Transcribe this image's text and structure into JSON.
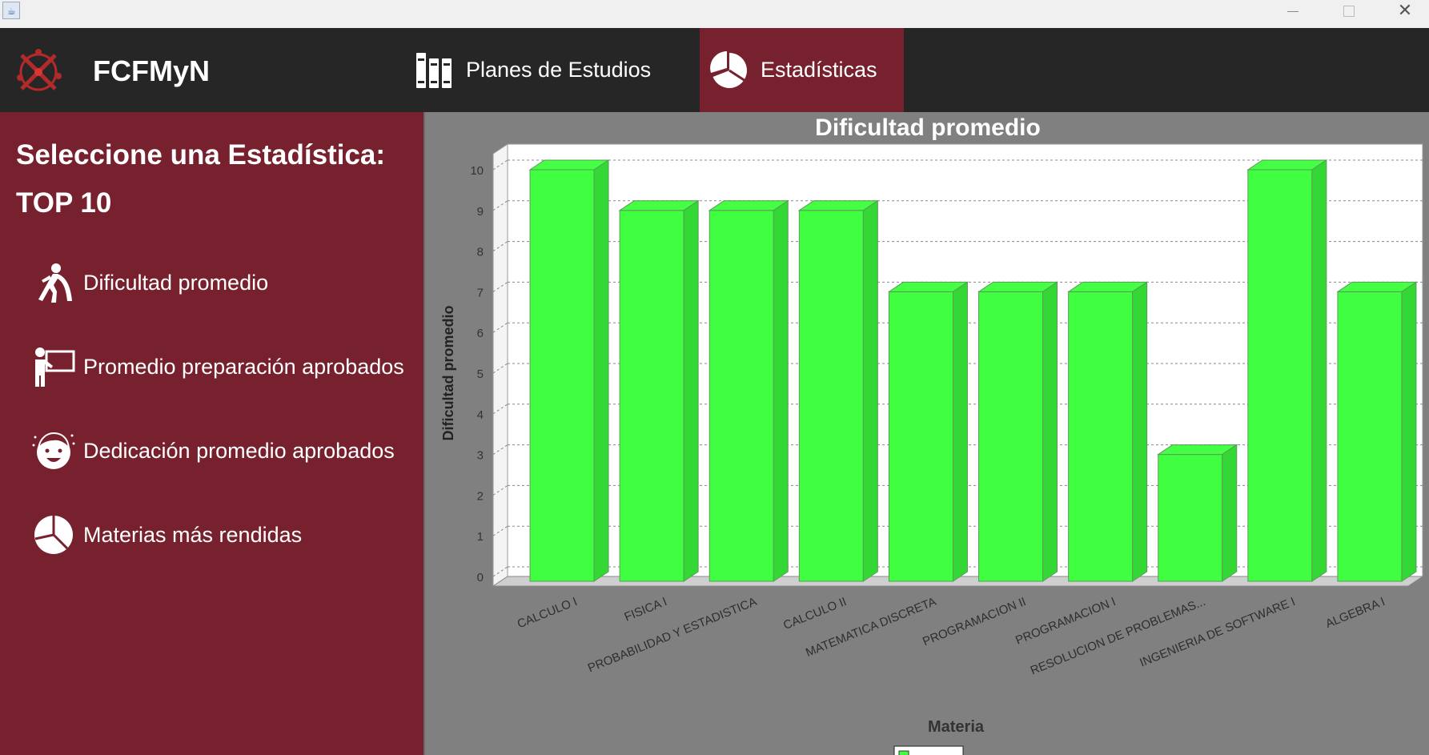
{
  "window": {
    "minimize_label": "",
    "maximize_label": "",
    "close_label": "✕"
  },
  "topnav": {
    "brand": "FCFMyN",
    "tabs": [
      {
        "label": "Planes de Estudios",
        "icon": "books-icon"
      },
      {
        "label": "Estadísticas",
        "icon": "pie-chart-icon",
        "active": true
      }
    ]
  },
  "sidebar": {
    "title": "Seleccione una Estadística:",
    "subtitle": "TOP 10",
    "items": [
      {
        "label": "Dificultad promedio",
        "icon": "struggling-person-icon"
      },
      {
        "label": "Promedio preparación aprobados",
        "icon": "presenter-icon"
      },
      {
        "label": "Dedicación promedio aprobados",
        "icon": "face-icon"
      },
      {
        "label": "Materias más rendidas",
        "icon": "pie-chart-icon"
      }
    ]
  },
  "colors": {
    "bar": "#40ff40",
    "accent": "#77212f",
    "nav": "#262626",
    "panel": "#808080"
  },
  "chart_data": {
    "type": "bar",
    "title": "Dificultad promedio",
    "xlabel": "Materia",
    "ylabel": "Dificultad promedio",
    "ylim": [
      0,
      10
    ],
    "yticks": [
      0,
      1,
      2,
      3,
      4,
      5,
      6,
      7,
      8,
      9,
      10
    ],
    "grid": true,
    "legend_position": "bottom",
    "categories": [
      "CALCULO I",
      "FISICA I",
      "PROBABILIDAD Y ESTADISTICA",
      "CALCULO II",
      "MATEMATICA DISCRETA",
      "PROGRAMACION II",
      "PROGRAMACION I",
      "RESOLUCION DE PROBLEMAS...",
      "INGENIERIA DE SOFTWARE I",
      "ALGEBRA I"
    ],
    "values": [
      10,
      9,
      9,
      9,
      7,
      7,
      7,
      3,
      10,
      7
    ]
  }
}
